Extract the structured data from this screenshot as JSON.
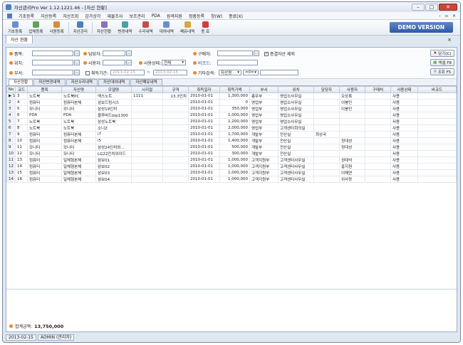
{
  "window": {
    "title": "자산관리Pro Ver 1.12.1221.46 - [자산 현황]"
  },
  "menu": [
    "기초등록",
    "자산등록",
    "자산조회",
    "감가상각",
    "재물조사",
    "보조관리",
    "PDA",
    "원격지원",
    "정품등록",
    "창(W)",
    "종료(X)"
  ],
  "toolbar": {
    "buttons": [
      {
        "label": "기초등록",
        "color": "#6a8fcf"
      },
      {
        "label": "업체등록",
        "color": "#5ca35c"
      },
      {
        "label": "사원등록",
        "color": "#d88b3b"
      },
      {
        "label": "자산관리",
        "color": "#4d7fbf"
      },
      {
        "label": "자산현황",
        "color": "#8c6fbf"
      },
      {
        "label": "변경내역",
        "color": "#4aa3a3"
      },
      {
        "label": "수리내역",
        "color": "#c94b4b"
      },
      {
        "label": "대여내역",
        "color": "#6a8fcf"
      },
      {
        "label": "폐유내역",
        "color": "#d6a83c"
      },
      {
        "label": "종 료",
        "color": "#d83b3b"
      }
    ],
    "demo": "DEMO VERSION"
  },
  "doc_tab": "자산 현황",
  "filters": {
    "item": "품목:",
    "manager": "담당자:",
    "buyer": "구매처:",
    "exclude_disposed": "종결자산 제외",
    "location": "위치:",
    "user": "사용자:",
    "status_label": "사용상태:",
    "status_value": "전체",
    "barcode": "바코드:",
    "dept": "부서:",
    "acq_period": "취득기간:",
    "date_from": "2013-02-15",
    "date_to": "2013-02-15",
    "tilde": "~",
    "other": "기타검색:",
    "other_field": "자산명",
    "other_op": "=0="
  },
  "side_buttons": {
    "close": "닫기(C)",
    "excel": "엑셀 F8",
    "search": "조회 F5"
  },
  "tabs": [
    "자산현황",
    "자산변경내역",
    "자산수리내역",
    "자산대여내역",
    "자산폐유내역"
  ],
  "columns": [
    "No",
    "코드",
    "품목",
    "자산명",
    "모델명",
    "시리얼",
    "규격",
    "취득일자",
    "취득가액",
    "부서",
    "위치",
    "담당자",
    "사용자",
    "구매처",
    "사용상태",
    "바코드"
  ],
  "rows": [
    [
      "1",
      "3",
      "노트북",
      "노트북PC",
      "엑스노트",
      "1111",
      "13.3인치",
      "2010-01-01",
      "1,300,000",
      "총무부",
      "영업소사무실",
      "",
      "오상록",
      "",
      "사용",
      ""
    ],
    [
      "2",
      "4",
      "컴퓨터",
      "컴퓨터본체",
      "삼보드림시스",
      "",
      "",
      "2010-01-01",
      "0",
      "영업부",
      "영업소사무실",
      "",
      "이봉민",
      "",
      "사용",
      ""
    ],
    [
      "3",
      "5",
      "모니터",
      "모니터",
      "삼성19인치",
      "",
      "",
      "2010-01-01",
      "350,000",
      "영업부",
      "영업소사무실",
      "",
      "이봉민",
      "",
      "사용",
      ""
    ],
    [
      "4",
      "6",
      "PDA",
      "PDA",
      "블루버드bip1300",
      "",
      "",
      "2010-01-01",
      "1,000,000",
      "영업부",
      "영업소사무실",
      "",
      "",
      "",
      "사용",
      ""
    ],
    [
      "5",
      "7",
      "노트북",
      "노트북",
      "삼성노트북",
      "",
      "",
      "2010-01-01",
      "1,200,000",
      "영업부",
      "영업소사무실",
      "",
      "",
      "",
      "사용",
      ""
    ],
    [
      "6",
      "8",
      "노트북",
      "노트북",
      "소니Z",
      "",
      "",
      "2010-01-01",
      "2,000,000",
      "영업부",
      "고객센터회의실",
      "",
      "",
      "",
      "사용",
      ""
    ],
    [
      "7",
      "9",
      "컴퓨터",
      "컴퓨터본체",
      "i7",
      "",
      "",
      "2010-01-01",
      "1,700,000",
      "개발부",
      "전산실",
      "최상국",
      "",
      "",
      "사용",
      ""
    ],
    [
      "8",
      "10",
      "컴퓨터",
      "컴퓨터본체",
      "i5",
      "",
      "",
      "2010-01-01",
      "1,400,000",
      "개발부",
      "전산실",
      "",
      "정대성",
      "",
      "사용",
      ""
    ],
    [
      "9",
      "11",
      "모니터",
      "모니터",
      "삼성24인치와...",
      "",
      "",
      "2010-01-01",
      "500,000",
      "개발부",
      "전산실",
      "",
      "정대성",
      "",
      "사용",
      ""
    ],
    [
      "10",
      "12",
      "모니터",
      "모니터",
      "LG22인치와이드",
      "",
      "",
      "2010-01-01",
      "300,000",
      "개발부",
      "전산실",
      "",
      "",
      "",
      "사용",
      ""
    ],
    [
      "11",
      "13",
      "컴퓨터",
      "일체형본체",
      "삼보01",
      "",
      "",
      "2010-01-01",
      "1,000,000",
      "고객지원부",
      "고객센터사무실",
      "",
      "권태석",
      "",
      "사용",
      ""
    ],
    [
      "12",
      "14",
      "컴퓨터",
      "일체형본체",
      "삼보02",
      "",
      "",
      "2010-01-01",
      "1,000,000",
      "고객지원부",
      "고객센터사무실",
      "",
      "홍지원",
      "",
      "사용",
      ""
    ],
    [
      "13",
      "15",
      "컴퓨터",
      "일체형본체",
      "삼보03",
      "",
      "",
      "2010-01-01",
      "1,000,000",
      "고객지원부",
      "고객센터사무실",
      "",
      "이해연",
      "",
      "사용",
      ""
    ],
    [
      "14",
      "16",
      "컴퓨터",
      "일체형본체",
      "삼보04",
      "",
      "",
      "2010-01-01",
      "1,000,000",
      "고객지원부",
      "고객센터사무실",
      "",
      "위사랑",
      "",
      "사용",
      ""
    ]
  ],
  "total": {
    "label": "합계금액:",
    "value": "13,750,000"
  },
  "status": {
    "date": "2013-02-15",
    "user": "ADMIN (관리자)"
  }
}
